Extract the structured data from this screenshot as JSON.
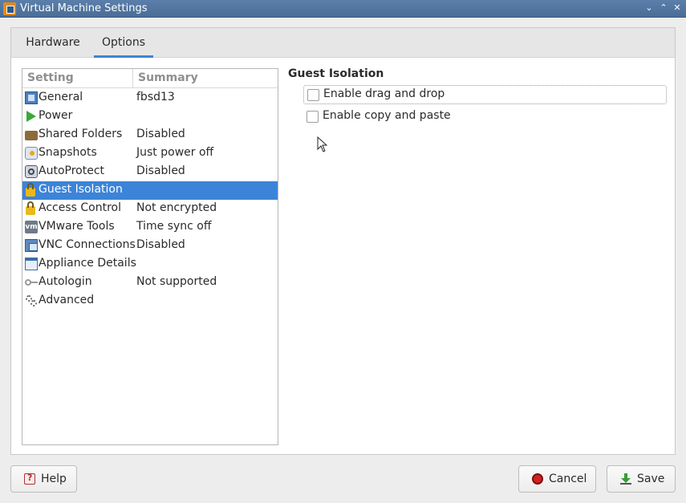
{
  "window": {
    "title": "Virtual Machine Settings",
    "controls": [
      "chevron-down-icon",
      "chevron-up-icon",
      "close-icon"
    ]
  },
  "tabs": [
    {
      "label": "Hardware",
      "active": false
    },
    {
      "label": "Options",
      "active": true
    }
  ],
  "settings_list": {
    "headers": {
      "setting": "Setting",
      "summary": "Summary"
    },
    "rows": [
      {
        "name": "General",
        "summary": "fbsd13",
        "icon": "general-icon"
      },
      {
        "name": "Power",
        "summary": "",
        "icon": "power-icon"
      },
      {
        "name": "Shared Folders",
        "summary": "Disabled",
        "icon": "folder-icon"
      },
      {
        "name": "Snapshots",
        "summary": "Just power off",
        "icon": "snapshot-icon"
      },
      {
        "name": "AutoProtect",
        "summary": "Disabled",
        "icon": "autoprotect-icon"
      },
      {
        "name": "Guest Isolation",
        "summary": "",
        "icon": "lock-icon",
        "selected": true
      },
      {
        "name": "Access Control",
        "summary": "Not encrypted",
        "icon": "lock-icon"
      },
      {
        "name": "VMware Tools",
        "summary": "Time sync off",
        "icon": "vmware-tools-icon",
        "icon_text": "vm"
      },
      {
        "name": "VNC Connections",
        "summary": "Disabled",
        "icon": "vnc-icon"
      },
      {
        "name": "Appliance Details",
        "summary": "",
        "icon": "appliance-icon"
      },
      {
        "name": "Autologin",
        "summary": "Not supported",
        "icon": "key-icon"
      },
      {
        "name": "Advanced",
        "summary": "",
        "icon": "gears-icon"
      }
    ]
  },
  "panel": {
    "title": "Guest Isolation",
    "options": [
      {
        "label": "Enable drag and drop",
        "checked": false
      },
      {
        "label": "Enable copy and paste",
        "checked": false
      }
    ]
  },
  "buttons": {
    "help": "Help",
    "cancel": "Cancel",
    "save": "Save"
  },
  "colors": {
    "accent": "#3c84d8",
    "titlebar": "#4f72a0",
    "power_green": "#3aa83a",
    "cancel_red": "#d32020"
  }
}
